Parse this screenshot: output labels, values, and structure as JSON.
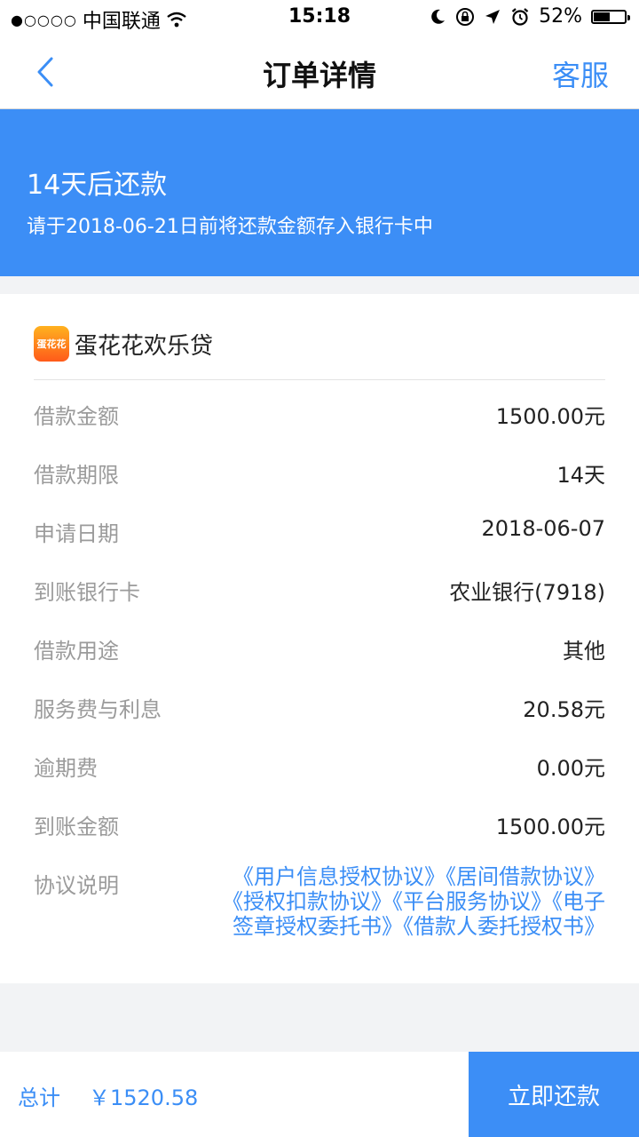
{
  "status_bar": {
    "signal": "●○○○○",
    "carrier": "中国联通",
    "time": "15:18",
    "battery": "52%",
    "battery_level": 0.52
  },
  "nav": {
    "title": "订单详情",
    "service": "客服"
  },
  "banner": {
    "title": "14天后还款",
    "subtitle": "请于2018-06-21日前将还款金额存入银行卡中"
  },
  "product": {
    "logo_text": "蛋花花",
    "name": "蛋花花欢乐贷"
  },
  "details": [
    {
      "label": "借款金额",
      "value": "1500.00元"
    },
    {
      "label": "借款期限",
      "value": "14天"
    },
    {
      "label": "申请日期",
      "value": "2018-06-07"
    },
    {
      "label": "到账银行卡",
      "value": "农业银行(7918)"
    },
    {
      "label": "借款用途",
      "value": "其他"
    },
    {
      "label": "服务费与利息",
      "value": "20.58元"
    },
    {
      "label": "逾期费",
      "value": "0.00元"
    },
    {
      "label": "到账金额",
      "value": "1500.00元"
    }
  ],
  "agreements": {
    "label": "协议说明",
    "items": [
      "《用户信息授权协议》",
      "《居间借款协议》",
      "《授权扣款协议》",
      "《平台服务协议》",
      "《电子签章授权委托书》",
      "《借款人委托授权书》"
    ]
  },
  "footer": {
    "total_label": "总计",
    "total_amount": "￥1520.58",
    "pay_button": "立即还款"
  },
  "colors": {
    "accent": "#3c8ef6",
    "link": "#3b8ef6"
  }
}
